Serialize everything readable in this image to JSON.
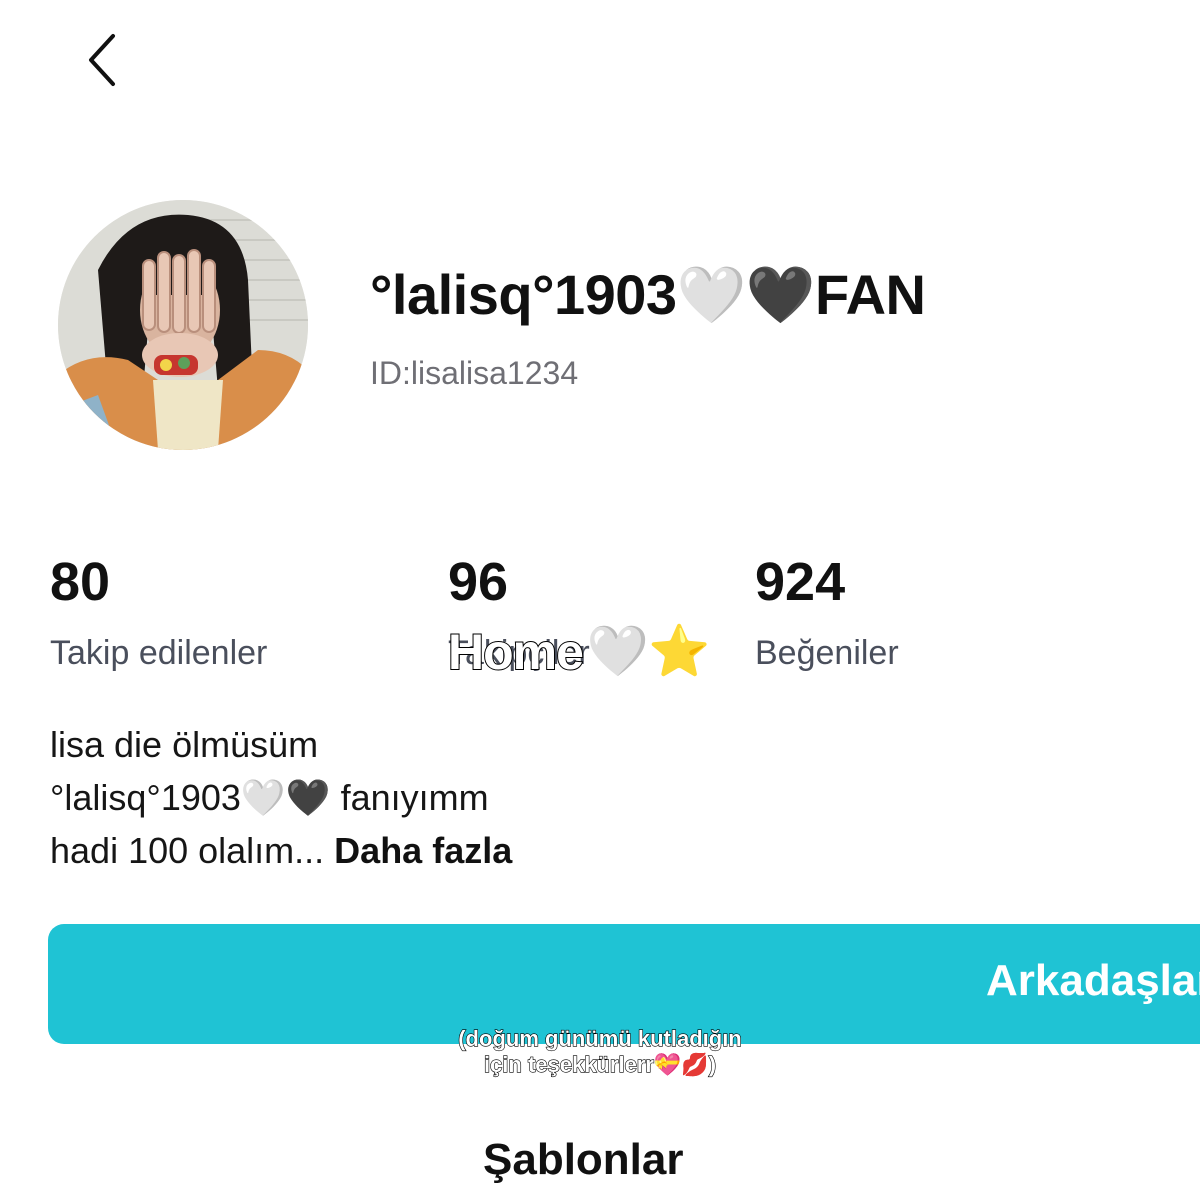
{
  "header": {
    "back_icon": "chevron-left-icon"
  },
  "profile": {
    "username": "°lalisq°1903🤍🖤FAN",
    "id_text": "ID:lisalisa1234"
  },
  "stats": {
    "following": {
      "value": "80",
      "label": "Takip edilenler"
    },
    "followers": {
      "value": "96",
      "label": "Takipçiler"
    },
    "likes": {
      "value": "924",
      "label": "Beğeniler"
    }
  },
  "sticker": {
    "text": "Home",
    "emoji": "🤍⭐"
  },
  "bio": {
    "line1": "lisa die ölmüsüm",
    "line2": "°lalisq°1903🤍🖤 fanıyımm",
    "line3": "hadi 100 olalım...",
    "more_label": "Daha fazla"
  },
  "actions": {
    "friends_label": "Arkadaşlar"
  },
  "caption": {
    "line1": "(doğum günümü kutladığın",
    "line2": "için teşekkürlerr💝💋)"
  },
  "tabs": {
    "templates_label": "Şablonlar"
  },
  "colors": {
    "accent": "#1fc3d4"
  }
}
